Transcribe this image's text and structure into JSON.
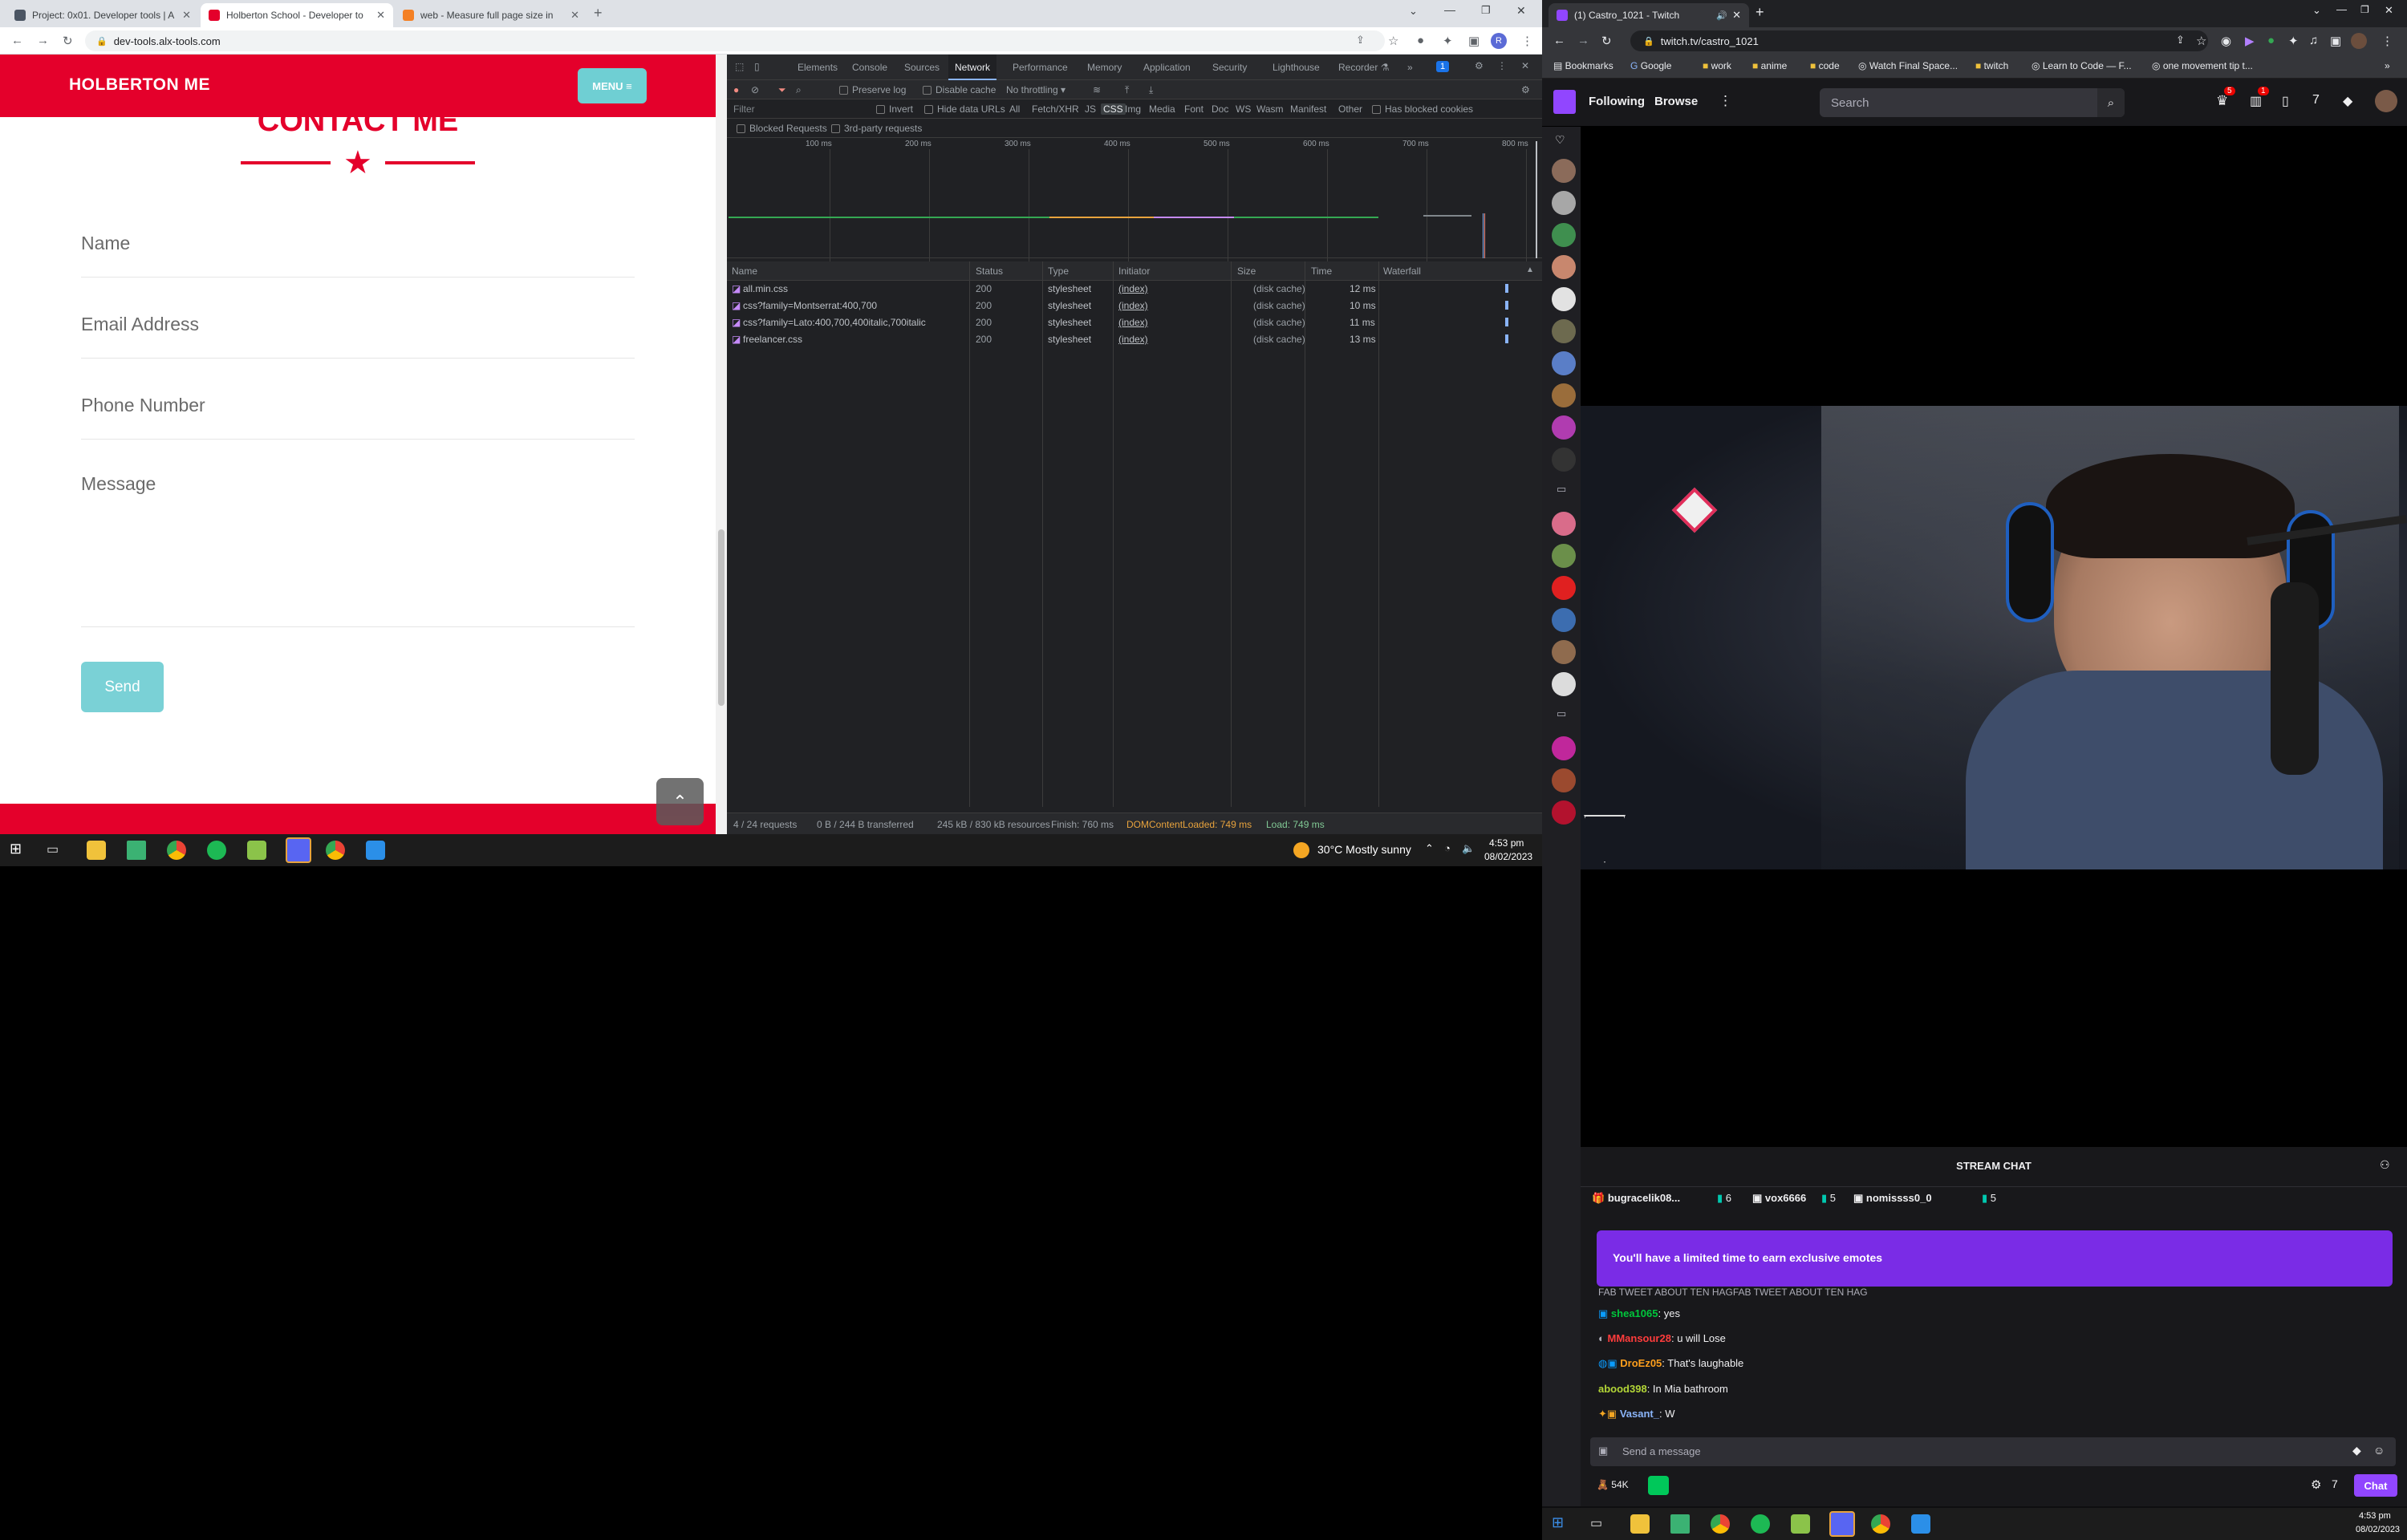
{
  "left_browser": {
    "tabs": [
      {
        "title": "Project: 0x01. Developer tools | A",
        "fav_color": "#4b5563"
      },
      {
        "title": "Holberton School - Developer to",
        "fav_color": "#e4002b"
      },
      {
        "title": "web - Measure full page size in",
        "fav_color": "#f48024"
      }
    ],
    "url": "dev-tools.alx-tools.com",
    "avatar_letter": "R"
  },
  "site": {
    "brand": "HOLBERTON ME",
    "menu_label": "MENU ≡",
    "section_title": "CONTACT ME",
    "fields": [
      "Name",
      "Email Address",
      "Phone Number",
      "Message"
    ],
    "send_label": "Send",
    "to_top_icon": "⌃",
    "accent": "#e4002b",
    "teal": "#6fcfd3"
  },
  "devtools": {
    "tabs": [
      "Elements",
      "Console",
      "Sources",
      "Network",
      "Performance",
      "Memory",
      "Application",
      "Security",
      "Lighthouse",
      "Recorder ⚗",
      "»"
    ],
    "active_tab": "Network",
    "issues_badge": "1",
    "toolbar": {
      "preserve_log": "Preserve log",
      "disable_cache": "Disable cache",
      "throttling": "No throttling"
    },
    "filter": {
      "placeholder": "Filter",
      "invert": "Invert",
      "hide_data_urls": "Hide data URLs",
      "types": [
        "All",
        "Fetch/XHR",
        "JS",
        "CSS",
        "Img",
        "Media",
        "Font",
        "Doc",
        "WS",
        "Wasm",
        "Manifest",
        "Other"
      ],
      "active_type": "CSS",
      "has_blocked_cookies": "Has blocked cookies",
      "blocked_requests": "Blocked Requests",
      "third_party": "3rd-party requests"
    },
    "timeline_ticks": [
      "100 ms",
      "200 ms",
      "300 ms",
      "400 ms",
      "500 ms",
      "600 ms",
      "700 ms",
      "800 ms"
    ],
    "columns": [
      "Name",
      "Status",
      "Type",
      "Initiator",
      "Size",
      "Time",
      "Waterfall"
    ],
    "requests": [
      {
        "name": "all.min.css",
        "status": "200",
        "type": "stylesheet",
        "initiator": "(index)",
        "size": "(disk cache)",
        "time": "12 ms"
      },
      {
        "name": "css?family=Montserrat:400,700",
        "status": "200",
        "type": "stylesheet",
        "initiator": "(index)",
        "size": "(disk cache)",
        "time": "10 ms"
      },
      {
        "name": "css?family=Lato:400,700,400italic,700italic",
        "status": "200",
        "type": "stylesheet",
        "initiator": "(index)",
        "size": "(disk cache)",
        "time": "11 ms"
      },
      {
        "name": "freelancer.css",
        "status": "200",
        "type": "stylesheet",
        "initiator": "(index)",
        "size": "(disk cache)",
        "time": "13 ms"
      }
    ],
    "status": {
      "requests": "4 / 24 requests",
      "transferred": "0 B / 244 B transferred",
      "resources": "245 kB / 830 kB resources",
      "finish": "Finish: 760 ms",
      "dom_loaded": "DOMContentLoaded: 749 ms",
      "load": "Load: 749 ms"
    }
  },
  "taskbar_left": {
    "weather": "30°C  Mostly sunny",
    "time": "4:53 pm",
    "date": "08/02/2023"
  },
  "right_browser": {
    "tab_title": "(1) Castro_1021 - Twitch",
    "url": "twitch.tv/castro_1021",
    "bookmarks": [
      "Bookmarks",
      "Google",
      "work",
      "anime",
      "code",
      "Watch Final Space...",
      "twitch",
      "Learn to Code — F...",
      "one movement tip t..."
    ]
  },
  "twitch": {
    "nav": {
      "following": "Following",
      "browse": "Browse",
      "search_placeholder": "Search",
      "notif_badge_1": "5",
      "notif_badge_2": "1"
    },
    "chat": {
      "header": "STREAM CHAT",
      "gifters": [
        {
          "name": "bugracelik08...",
          "count": "6"
        },
        {
          "name": "vox6666",
          "count": "5"
        },
        {
          "name": "nomissss0_0",
          "count": "5"
        }
      ],
      "partial_line": "FAB TWEET ABOUT TEN HAGFAB TWEET ABOUT TEN HAG",
      "banner": "You'll have a limited time to earn exclusive emotes",
      "messages": [
        {
          "user": "shea1065",
          "text": "yes",
          "color": "#00c83c"
        },
        {
          "user": "MMansour28",
          "text": "u will Lose",
          "color": "#ff3c3c"
        },
        {
          "user": "DroEz05",
          "text": "That's laughable",
          "color": "#ff9f1c"
        },
        {
          "user": "abood398",
          "text": "In Mia bathroom",
          "color": "#b3d637"
        },
        {
          "user": "Vasant_",
          "text": "W",
          "color": "#8ab4f8"
        }
      ],
      "input_placeholder": "Send a message",
      "points": "54K",
      "chat_button": "Chat"
    }
  },
  "taskbar_right": {
    "time": "4:53 pm",
    "date": "08/02/2023"
  }
}
